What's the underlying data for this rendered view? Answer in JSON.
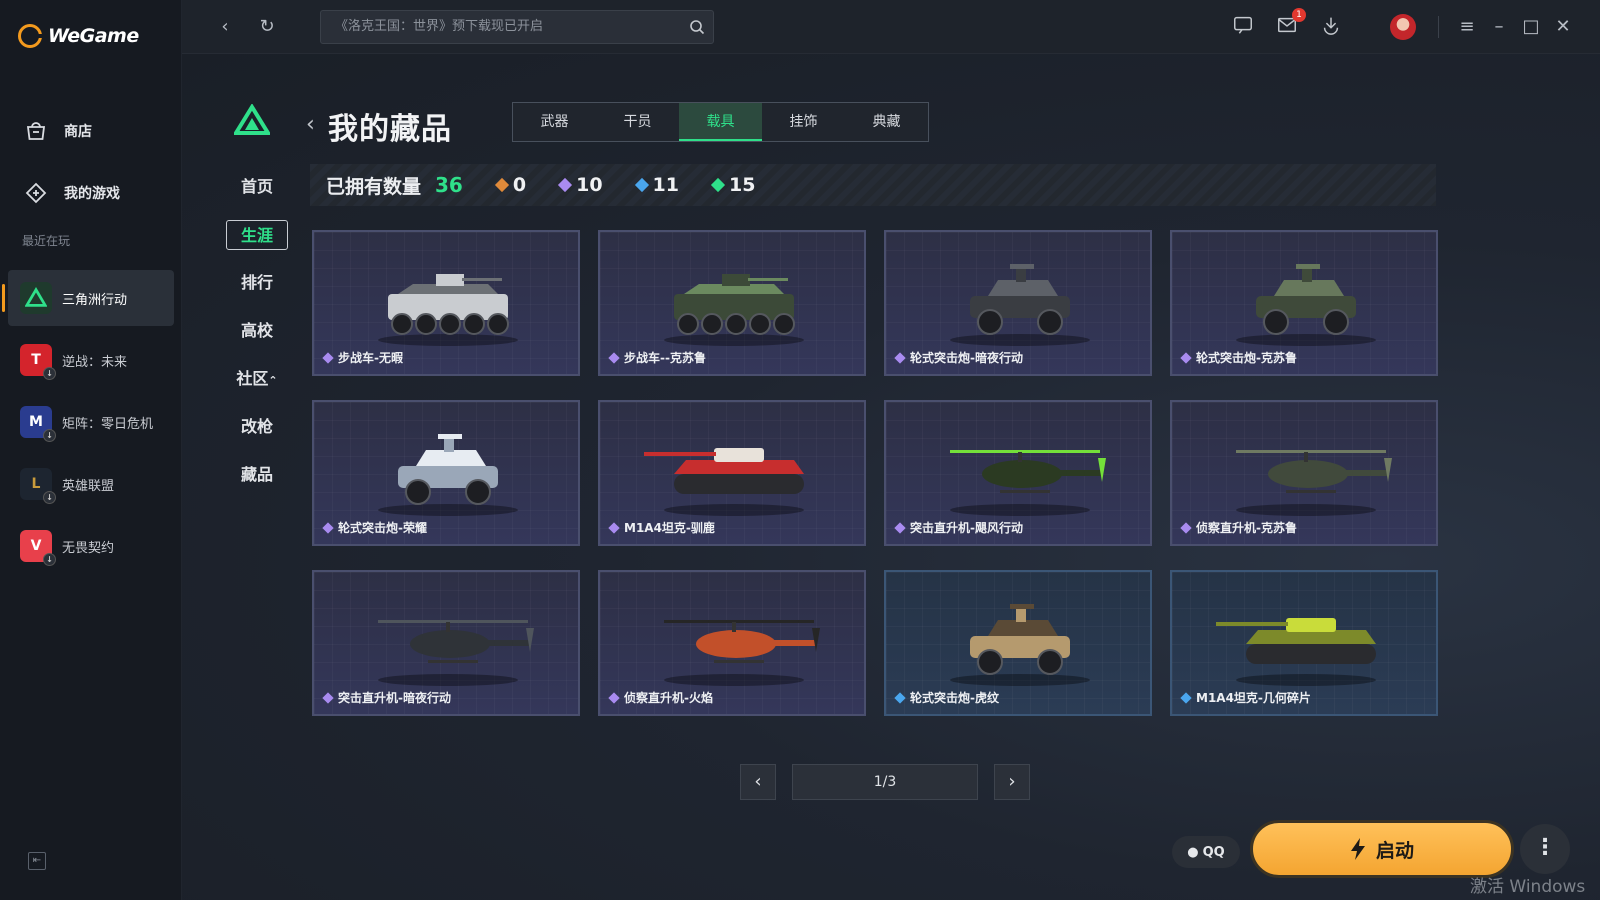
{
  "app": {
    "name": "WeGame"
  },
  "sidebar": {
    "nav": [
      {
        "label": "商店",
        "icon": "store-icon"
      },
      {
        "label": "我的游戏",
        "icon": "my-games-icon"
      }
    ],
    "recent_label": "最近在玩",
    "recent_games": [
      {
        "label": "三角洲行动",
        "active": true
      },
      {
        "label": "逆战：未来",
        "active": false
      },
      {
        "label": "矩阵：零日危机",
        "active": false
      },
      {
        "label": "英雄联盟",
        "active": false
      },
      {
        "label": "无畏契约",
        "active": false
      }
    ]
  },
  "topbar": {
    "search_placeholder": "《洛克王国：世界》预下载现已开启",
    "mail_badge": "1"
  },
  "game_nav": {
    "items": [
      "首页",
      "生涯",
      "排行",
      "高校",
      "社区",
      "改枪",
      "藏品"
    ],
    "active": "生涯"
  },
  "collection": {
    "title": "我的藏品",
    "tabs": [
      "武器",
      "干员",
      "载具",
      "挂饰",
      "典藏"
    ],
    "active_tab": "载具",
    "owned_label": "已拥有数量",
    "owned_total": "36",
    "rarity_counts": [
      {
        "color": "#e08a3a",
        "value": "0"
      },
      {
        "color": "#a98bf0",
        "value": "10"
      },
      {
        "color": "#4aa6ee",
        "value": "11"
      },
      {
        "color": "#2fe08a",
        "value": "15"
      }
    ],
    "items": [
      {
        "name": "步战车-无暇",
        "rarity": "purple",
        "vehicle": "apc",
        "body": "#c9ccd0",
        "accent": "#6c7075"
      },
      {
        "name": "步战车--克苏鲁",
        "rarity": "purple",
        "vehicle": "apc",
        "body": "#3c4a38",
        "accent": "#6b8a5f"
      },
      {
        "name": "轮式突击炮-暗夜行动",
        "rarity": "purple",
        "vehicle": "jeep",
        "body": "#3a3d42",
        "accent": "#5d6168"
      },
      {
        "name": "轮式突击炮-克苏鲁",
        "rarity": "purple",
        "vehicle": "jeep",
        "body": "#3f4a3a",
        "accent": "#67785c"
      },
      {
        "name": "轮式突击炮-荣耀",
        "rarity": "purple",
        "vehicle": "jeep",
        "body": "#9aa7b8",
        "accent": "#e7ecf2"
      },
      {
        "name": "M1A4坦克-驯鹿",
        "rarity": "purple",
        "vehicle": "tank",
        "body": "#c72e2e",
        "accent": "#e8e2da"
      },
      {
        "name": "突击直升机-飓风行动",
        "rarity": "purple",
        "vehicle": "heli",
        "body": "#2b3a22",
        "accent": "#74e03a"
      },
      {
        "name": "侦察直升机-克苏鲁",
        "rarity": "purple",
        "vehicle": "heli",
        "body": "#414a3c",
        "accent": "#6f7a62"
      },
      {
        "name": "突击直升机-暗夜行动",
        "rarity": "purple",
        "vehicle": "heli",
        "body": "#2f3338",
        "accent": "#4f555c"
      },
      {
        "name": "侦察直升机-火焰",
        "rarity": "purple",
        "vehicle": "heli",
        "body": "#c2502a",
        "accent": "#262626"
      },
      {
        "name": "轮式突击炮-虎纹",
        "rarity": "blue",
        "vehicle": "jeep",
        "body": "#b59a6e",
        "accent": "#5a4a36"
      },
      {
        "name": "M1A4坦克-几何碎片",
        "rarity": "blue",
        "vehicle": "tank",
        "body": "#7d8a2a",
        "accent": "#c9dc3a"
      }
    ]
  },
  "pagination": {
    "current": "1/3"
  },
  "launch": {
    "qq_label": "QQ",
    "start_label": "启动"
  },
  "watermark": "激活 Windows",
  "colors": {
    "accent_green": "#2fe08a",
    "brand_orange": "#f39a1e",
    "launch_orange": "#f4a531"
  }
}
